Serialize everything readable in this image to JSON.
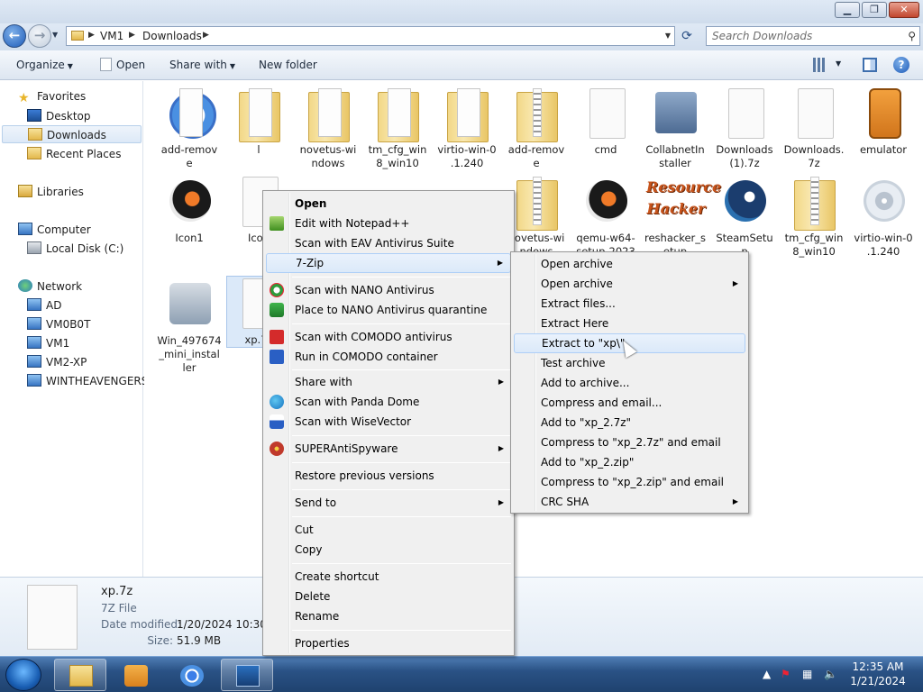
{
  "window": {
    "minimize": "▁",
    "maximize": "❐",
    "close": "✕"
  },
  "address": {
    "crumbs": [
      "VM1",
      "Downloads"
    ],
    "search_placeholder": "Search Downloads"
  },
  "toolbar": {
    "organize": "Organize",
    "open": "Open",
    "share_with": "Share with",
    "new_folder": "New folder"
  },
  "nav": {
    "favorites": "Favorites",
    "desktop": "Desktop",
    "downloads": "Downloads",
    "recent_places": "Recent Places",
    "libraries": "Libraries",
    "computer": "Computer",
    "local_disk": "Local Disk (C:)",
    "network": "Network",
    "network_items": [
      "AD",
      "VM0B0T",
      "VM1",
      "VM2-XP",
      "WINTHEAVENGERS"
    ]
  },
  "files": [
    {
      "name": "add-remove",
      "icon": "chrome-folder-icon"
    },
    {
      "name": "l",
      "icon": "folder-icon"
    },
    {
      "name": "novetus-windows",
      "icon": "folder-icon"
    },
    {
      "name": "tm_cfg_win8_win10",
      "icon": "folder-icon"
    },
    {
      "name": "virtio-win-0.1.240",
      "icon": "folder-icon"
    },
    {
      "name": "add-remove",
      "icon": "zip-folder-icon"
    },
    {
      "name": "cmd",
      "icon": "file-icon"
    },
    {
      "name": "CollabnetInstaller",
      "icon": "installer-icon"
    },
    {
      "name": "Downloads (1).7z",
      "icon": "file-icon"
    },
    {
      "name": "Downloads.7z",
      "icon": "file-icon"
    },
    {
      "name": "emulator",
      "icon": "emulator-icon"
    },
    {
      "name": "Icon1",
      "icon": "bird-icon"
    },
    {
      "name": "Icon",
      "icon": "file-icon"
    },
    {
      "name": "novetus-windows",
      "icon": "zip-folder-icon"
    },
    {
      "name": "qemu-w64-setup-2023",
      "icon": "bird-shield-icon"
    },
    {
      "name": "reshacker_setup",
      "icon": "reshacker-icon"
    },
    {
      "name": "SteamSetup",
      "icon": "steam-icon"
    },
    {
      "name": "tm_cfg_win8_win10",
      "icon": "zip-folder-icon"
    },
    {
      "name": "virtio-win-0.1.240",
      "icon": "disc-icon"
    },
    {
      "name": "Win_497674_mini_installer",
      "icon": "installer-icon"
    },
    {
      "name": "xp.7z",
      "icon": "file-icon"
    }
  ],
  "file_labels": {
    "f0": [
      "add-remov",
      "e"
    ],
    "f1": [
      "l"
    ],
    "f2": [
      "novetus-wi",
      "ndows"
    ],
    "f3": [
      "tm_cfg_win",
      "8_win10"
    ],
    "f4": [
      "virtio-win-0",
      ".1.240"
    ],
    "f5": [
      "add-remov",
      "e"
    ],
    "f6": [
      "cmd"
    ],
    "f7": [
      "CollabnetIn",
      "staller"
    ],
    "f8": [
      "Downloads",
      "(1).7z"
    ],
    "f9": [
      "Downloads.",
      "7z"
    ],
    "f10": [
      "emulator"
    ],
    "f11": [
      "Icon1"
    ],
    "f12": [
      "Icon"
    ],
    "f13": [
      "novetus-wi",
      "ndows"
    ],
    "f14": [
      "qemu-w64-",
      "setup-2023"
    ],
    "f15": [
      "reshacker_s",
      "etup"
    ],
    "f16": [
      "SteamSetu",
      "p"
    ],
    "f17": [
      "tm_cfg_win",
      "8_win10"
    ],
    "f18": [
      "virtio-win-0",
      ".1.240"
    ],
    "f19": [
      "Win_497674",
      "_mini_instal",
      "ler"
    ],
    "f20": [
      "xp.7z"
    ]
  },
  "reshacker_logo": "Resource Hacker",
  "details": {
    "name": "xp.7z",
    "type": "7Z File",
    "date_label": "Date modified:",
    "date_value": "1/20/2024 10:30 PM",
    "size_label": "Size:",
    "size_value": "51.9 MB"
  },
  "context_menu": {
    "items": [
      {
        "label": "Open",
        "bold": true
      },
      {
        "label": "Edit with Notepad++",
        "icon": "notepadpp-icon"
      },
      {
        "label": "Scan with EAV Antivirus Suite"
      },
      {
        "label": "7-Zip",
        "submenu": true,
        "highlight": true
      },
      {
        "label": "Scan with NANO Antivirus",
        "icon": "nano-icon"
      },
      {
        "label": "Place to NANO Antivirus quarantine",
        "icon": "nano-lock-icon"
      },
      {
        "label": "Scan with COMODO antivirus",
        "icon": "comodo-icon"
      },
      {
        "label": "Run in COMODO container",
        "icon": "comodo-container-icon"
      },
      {
        "label": "Share with",
        "submenu": true
      },
      {
        "label": "Scan with Panda Dome",
        "icon": "panda-icon"
      },
      {
        "label": "Scan with WiseVector",
        "icon": "wisevector-icon"
      },
      {
        "label": "SUPERAntiSpyware",
        "submenu": true,
        "icon": "superantispyware-icon"
      },
      {
        "label": "Restore previous versions"
      },
      {
        "label": "Send to",
        "submenu": true
      },
      {
        "label": "Cut"
      },
      {
        "label": "Copy"
      },
      {
        "label": "Create shortcut"
      },
      {
        "label": "Delete"
      },
      {
        "label": "Rename"
      },
      {
        "label": "Properties"
      }
    ]
  },
  "sevenzip_menu": {
    "items": [
      {
        "label": "Open archive"
      },
      {
        "label": "Open archive",
        "submenu": true
      },
      {
        "label": "Extract files..."
      },
      {
        "label": "Extract Here"
      },
      {
        "label": "Extract to \"xp\\\"",
        "highlight": true
      },
      {
        "label": "Test archive"
      },
      {
        "label": "Add to archive..."
      },
      {
        "label": "Compress and email..."
      },
      {
        "label": "Add to \"xp_2.7z\""
      },
      {
        "label": "Compress to \"xp_2.7z\" and email"
      },
      {
        "label": "Add to \"xp_2.zip\""
      },
      {
        "label": "Compress to \"xp_2.zip\" and email"
      },
      {
        "label": "CRC SHA",
        "submenu": true
      }
    ]
  },
  "taskbar": {
    "time": "12:35 AM",
    "date": "1/21/2024"
  }
}
